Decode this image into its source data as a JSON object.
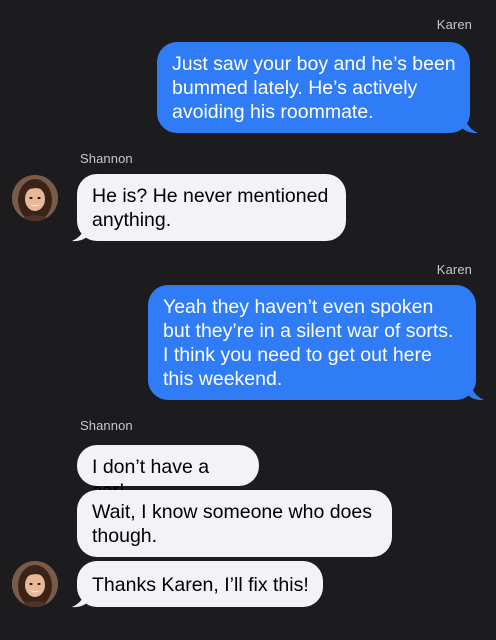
{
  "colors": {
    "background": "#1c1c1e",
    "outgoing_bubble": "#2f7cf6",
    "incoming_bubble": "#f2f2f7",
    "sender_label": "#c7c7cc"
  },
  "messages": [
    {
      "sender": "Karen",
      "direction": "outgoing",
      "text": "Just saw your boy and he’s been bummed lately. He’s actively avoiding his roommate."
    },
    {
      "sender": "Shannon",
      "direction": "incoming",
      "text": "He is? He never mentioned anything."
    },
    {
      "sender": "Karen",
      "direction": "outgoing",
      "text": "Yeah they haven’t even spoken but they’re in a silent war of sorts. I think you need to get out here this weekend."
    },
    {
      "sender": "Shannon",
      "direction": "incoming",
      "text": "I don’t have a car!"
    },
    {
      "sender": "Shannon",
      "direction": "incoming",
      "text": "Wait, I know someone who does though."
    },
    {
      "sender": "Shannon",
      "direction": "incoming",
      "text": "Thanks Karen, I’ll fix this!"
    }
  ],
  "avatars": [
    {
      "icon": "woman-portrait-avatar",
      "person": "Shannon"
    },
    {
      "icon": "woman-portrait-avatar",
      "person": "Shannon"
    }
  ]
}
